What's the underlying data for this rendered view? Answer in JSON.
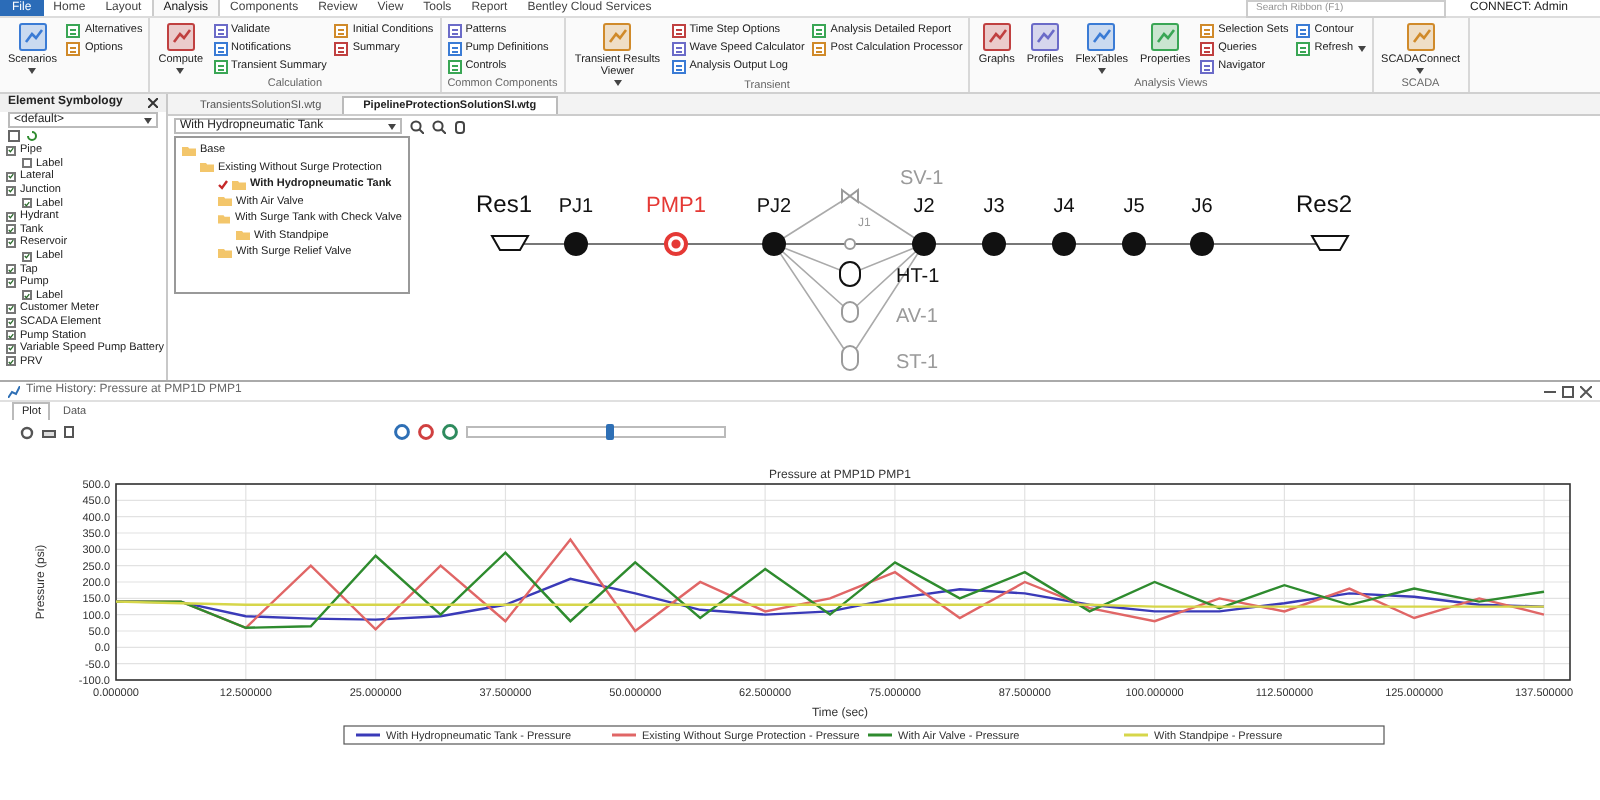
{
  "ribbon_tabs": [
    {
      "label": "File",
      "kind": "file",
      "selected": false
    },
    {
      "label": "Home",
      "kind": "tab",
      "selected": false
    },
    {
      "label": "Layout",
      "kind": "tab",
      "selected": false
    },
    {
      "label": "Analysis",
      "kind": "tab",
      "selected": true
    },
    {
      "label": "Components",
      "kind": "tab",
      "selected": false
    },
    {
      "label": "Review",
      "kind": "tab",
      "selected": false
    },
    {
      "label": "View",
      "kind": "tab",
      "selected": false
    },
    {
      "label": "Tools",
      "kind": "tab",
      "selected": false
    },
    {
      "label": "Report",
      "kind": "tab",
      "selected": false
    },
    {
      "label": "Bentley Cloud Services",
      "kind": "tab",
      "selected": false
    }
  ],
  "search": {
    "placeholder": "Search Ribbon (F1)"
  },
  "account": "CONNECT: Admin",
  "ribbon_groups": [
    {
      "items": [
        {
          "label": "Scenarios",
          "kind": "large",
          "dropdown": true
        },
        {
          "label": "Alternatives",
          "kind": "small"
        },
        {
          "label": "Options",
          "kind": "small"
        }
      ]
    },
    {
      "label": "Calculation",
      "items": [
        {
          "label": "Compute",
          "kind": "large",
          "dropdown": true
        },
        {
          "label": "Validate",
          "kind": "small"
        },
        {
          "label": "Notifications",
          "kind": "small"
        },
        {
          "label": "Transient Summary",
          "kind": "small"
        },
        {
          "label": "Initial Conditions",
          "kind": "small"
        },
        {
          "label": "Summary",
          "kind": "small"
        }
      ]
    },
    {
      "label": "Common Components",
      "items": [
        {
          "label": "Patterns",
          "kind": "small"
        },
        {
          "label": "Pump Definitions",
          "kind": "small"
        },
        {
          "label": "Controls",
          "kind": "small"
        }
      ]
    },
    {
      "label": "Transient",
      "items": [
        {
          "label": "Transient Results Viewer",
          "kind": "large",
          "dropdown": true
        },
        {
          "label": "Time Step Options",
          "kind": "small"
        },
        {
          "label": "Wave Speed Calculator",
          "kind": "small"
        },
        {
          "label": "Analysis Output Log",
          "kind": "small"
        },
        {
          "label": "Analysis Detailed Report",
          "kind": "small"
        },
        {
          "label": "Post Calculation Processor",
          "kind": "small"
        }
      ]
    },
    {
      "label": "Analysis Views",
      "items": [
        {
          "label": "Graphs",
          "kind": "large"
        },
        {
          "label": "Profiles",
          "kind": "large"
        },
        {
          "label": "FlexTables",
          "kind": "large",
          "dropdown": true
        },
        {
          "label": "Properties",
          "kind": "large"
        },
        {
          "label": "Selection Sets",
          "kind": "small"
        },
        {
          "label": "Queries",
          "kind": "small"
        },
        {
          "label": "Navigator",
          "kind": "small"
        },
        {
          "label": "Contour",
          "kind": "small"
        },
        {
          "label": "Refresh",
          "kind": "small",
          "dropdown": true
        }
      ]
    },
    {
      "label": "SCADA",
      "items": [
        {
          "label": "SCADAConnect",
          "kind": "large",
          "dropdown": true
        }
      ]
    }
  ],
  "symbology": {
    "title": "Element Symbology",
    "dropdown": "<default>",
    "items": [
      {
        "label": "Pipe",
        "checked": true,
        "children": [
          {
            "label": "Label",
            "checked": false
          }
        ]
      },
      {
        "label": "Lateral",
        "checked": true
      },
      {
        "label": "Junction",
        "checked": true,
        "children": [
          {
            "label": "Label",
            "checked": true
          }
        ]
      },
      {
        "label": "Hydrant",
        "checked": true
      },
      {
        "label": "Tank",
        "checked": true
      },
      {
        "label": "Reservoir",
        "checked": true,
        "children": [
          {
            "label": "Label",
            "checked": true
          }
        ]
      },
      {
        "label": "Tap",
        "checked": true
      },
      {
        "label": "Pump",
        "checked": true,
        "children": [
          {
            "label": "Label",
            "checked": true
          }
        ]
      },
      {
        "label": "Customer Meter",
        "checked": true
      },
      {
        "label": "SCADA Element",
        "checked": true
      },
      {
        "label": "Pump Station",
        "checked": true
      },
      {
        "label": "Variable Speed Pump Battery",
        "checked": true
      },
      {
        "label": "PRV",
        "checked": true
      }
    ]
  },
  "documents": [
    {
      "label": "TransientsSolutionSI.wtg",
      "selected": false
    },
    {
      "label": "PipelineProtectionSolutionSI.wtg",
      "selected": true
    }
  ],
  "scenario_select": "With Hydropneumatic Tank",
  "scenario_tree": [
    {
      "label": "Base",
      "current": false,
      "children": [
        {
          "label": "Existing Without Surge Protection",
          "current": false,
          "children": [
            {
              "label": "With Hydropneumatic Tank",
              "current": true
            },
            {
              "label": "With Air Valve",
              "current": false
            },
            {
              "label": "With Surge Tank with Check Valve",
              "current": false,
              "children": [
                {
                  "label": "With Standpipe",
                  "current": false
                }
              ]
            },
            {
              "label": "With Surge Relief Valve",
              "current": false
            }
          ]
        }
      ]
    }
  ],
  "network": {
    "nodes": [
      {
        "label": "SV-1",
        "kind": "valve",
        "active": false,
        "selected": false
      },
      {
        "label": "Res1",
        "kind": "reservoir",
        "active": true,
        "selected": false
      },
      {
        "label": "PJ1",
        "kind": "junction",
        "active": true,
        "selected": false
      },
      {
        "label": "PMP1",
        "kind": "pump",
        "active": true,
        "selected": true
      },
      {
        "label": "PJ2",
        "kind": "junction",
        "active": true,
        "selected": false
      },
      {
        "label": "J2",
        "kind": "junction",
        "active": true,
        "selected": false
      },
      {
        "label": "J3",
        "kind": "junction",
        "active": true,
        "selected": false
      },
      {
        "label": "J4",
        "kind": "junction",
        "active": true,
        "selected": false
      },
      {
        "label": "J5",
        "kind": "junction",
        "active": true,
        "selected": false
      },
      {
        "label": "J6",
        "kind": "junction",
        "active": true,
        "selected": false
      },
      {
        "label": "Res2",
        "kind": "reservoir",
        "active": true,
        "selected": false
      },
      {
        "label": "J1",
        "kind": "node",
        "active": false,
        "selected": false
      },
      {
        "label": "HT-1",
        "kind": "tank",
        "active": true,
        "selected": false
      },
      {
        "label": "AV-1",
        "kind": "air-valve",
        "active": false,
        "selected": false
      },
      {
        "label": "ST-1",
        "kind": "standpipe",
        "active": false,
        "selected": false
      }
    ]
  },
  "graph_window": {
    "title": "Time History: Pressure at PMP1D PMP1",
    "tabs": [
      {
        "label": "Plot",
        "selected": true
      },
      {
        "label": "Data",
        "selected": false
      }
    ],
    "playback": {
      "level": 0.55
    },
    "chart_data": {
      "type": "line",
      "title": "Pressure at PMP1D PMP1",
      "xlabel": "Time (sec)",
      "ylabel": "Pressure (psi)",
      "x": [
        0,
        6.25,
        12.5,
        18.75,
        25,
        31.25,
        37.5,
        43.75,
        50,
        56.25,
        62.5,
        68.75,
        75,
        81.25,
        87.5,
        93.75,
        100,
        106.25,
        112.5,
        118.75,
        125,
        131.25,
        137.5
      ],
      "series": [
        {
          "name": "With Hydropneumatic Tank - Pressure",
          "color": "#3a3ab8",
          "values": [
            140,
            138,
            95,
            88,
            85,
            95,
            130,
            210,
            165,
            115,
            100,
            110,
            150,
            178,
            165,
            130,
            110,
            110,
            135,
            165,
            155,
            130,
            125
          ]
        },
        {
          "name": "Existing Without Surge Protection - Pressure",
          "color": "#e06666",
          "values": [
            140,
            140,
            60,
            250,
            55,
            250,
            80,
            330,
            50,
            200,
            110,
            150,
            230,
            90,
            200,
            120,
            80,
            150,
            110,
            180,
            90,
            150,
            100
          ]
        },
        {
          "name": "With Air Valve - Pressure",
          "color": "#2e8b2e",
          "values": [
            140,
            140,
            60,
            65,
            280,
            100,
            290,
            80,
            260,
            90,
            240,
            100,
            260,
            150,
            230,
            110,
            200,
            120,
            190,
            130,
            180,
            140,
            170
          ]
        },
        {
          "name": "With Standpipe - Pressure",
          "color": "#d6d64a",
          "values": [
            140,
            135,
            130,
            130,
            130,
            130,
            130,
            130,
            130,
            130,
            130,
            130,
            130,
            130,
            130,
            130,
            125,
            125,
            125,
            125,
            125,
            125,
            125
          ]
        }
      ],
      "grid": true,
      "legend": true,
      "xlim": [
        0,
        140
      ],
      "ylim": [
        -100,
        500
      ],
      "xticks": [
        {
          "value": 0,
          "label": "0.000000"
        },
        {
          "value": 12.5,
          "label": "12.500000"
        },
        {
          "value": 25,
          "label": "25.000000"
        },
        {
          "value": 37.5,
          "label": "37.500000"
        },
        {
          "value": 50,
          "label": "50.000000"
        },
        {
          "value": 62.5,
          "label": "62.500000"
        },
        {
          "value": 75,
          "label": "75.000000"
        },
        {
          "value": 87.5,
          "label": "87.500000"
        },
        {
          "value": 100,
          "label": "100.000000"
        },
        {
          "value": 112.5,
          "label": "112.500000"
        },
        {
          "value": 125,
          "label": "125.000000"
        },
        {
          "value": 137.5,
          "label": "137.500000"
        }
      ],
      "yticks": [
        {
          "value": -100,
          "label": "-100.0"
        },
        {
          "value": -50,
          "label": "-50.0"
        },
        {
          "value": 0,
          "label": "0.0"
        },
        {
          "value": 50,
          "label": "50.0"
        },
        {
          "value": 100,
          "label": "100.0"
        },
        {
          "value": 150,
          "label": "150.0"
        },
        {
          "value": 200,
          "label": "200.0"
        },
        {
          "value": 250,
          "label": "250.0"
        },
        {
          "value": 300,
          "label": "300.0"
        },
        {
          "value": 350,
          "label": "350.0"
        },
        {
          "value": 400,
          "label": "400.0"
        },
        {
          "value": 450,
          "label": "450.0"
        },
        {
          "value": 500,
          "label": "500.0"
        }
      ]
    }
  }
}
